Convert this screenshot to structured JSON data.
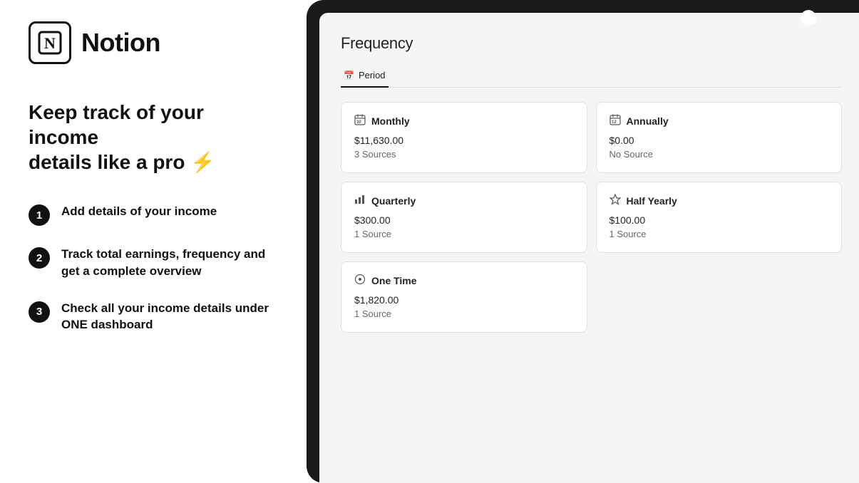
{
  "logo": {
    "icon_letter": "N",
    "text": "Notion"
  },
  "headline": {
    "line1": "Keep track of your income",
    "line2": "details like a pro",
    "lightning": "⚡"
  },
  "steps": [
    {
      "number": "1",
      "text": "Add details of your income"
    },
    {
      "number": "2",
      "text": "Track total earnings, frequency and get a complete overview"
    },
    {
      "number": "3",
      "text": "Check all your income details under ONE dashboard"
    }
  ],
  "screen": {
    "title": "Frequency",
    "tab_icon": "📅",
    "tab_label": "Period",
    "cards": [
      {
        "icon": "📅",
        "title": "Monthly",
        "amount": "$11,630.00",
        "source": "3 Sources"
      },
      {
        "icon": "📅",
        "title": "Annually",
        "amount": "$0.00",
        "source": "No Source"
      },
      {
        "icon": "📊",
        "title": "Quarterly",
        "amount": "$300.00",
        "source": "1 Source"
      },
      {
        "icon": "⭐",
        "title": "Half Yearly",
        "amount": "$100.00",
        "source": "1 Source"
      },
      {
        "icon": "⊕",
        "title": "One Time",
        "amount": "$1,820.00",
        "source": "1 Source"
      }
    ]
  }
}
